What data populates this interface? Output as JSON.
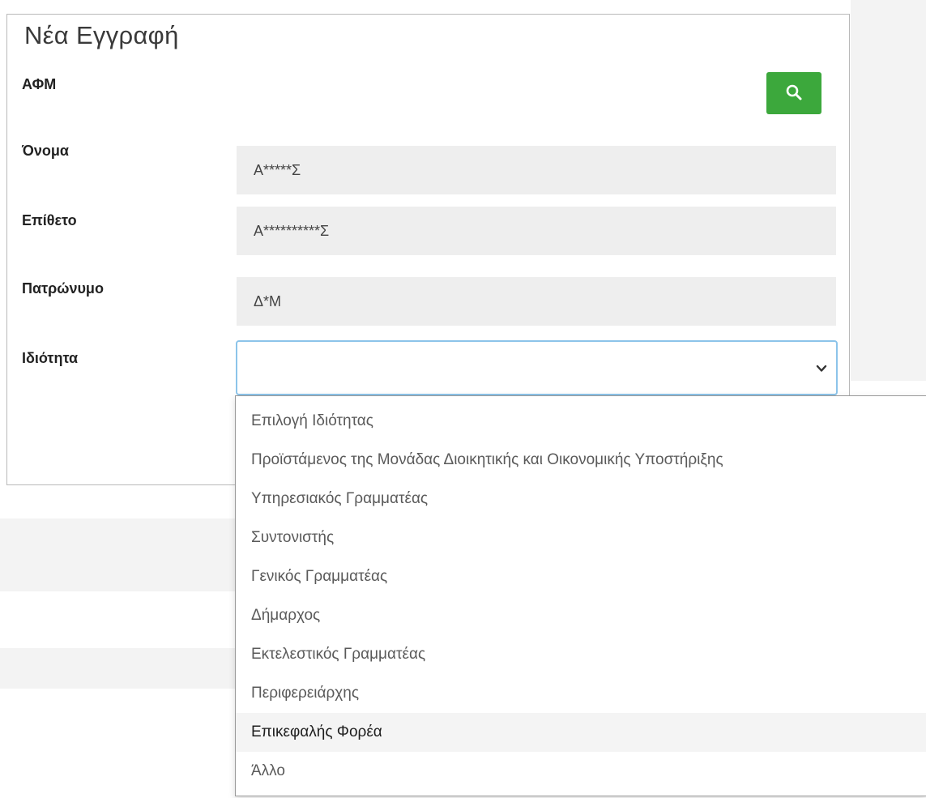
{
  "form": {
    "title": "Νέα Εγγραφή",
    "afm_label": "ΑΦΜ",
    "first_name_label": "Όνομα",
    "first_name_value": "Α*****Σ",
    "last_name_label": "Επίθετο",
    "last_name_value": "Α**********Σ",
    "father_name_label": "Πατρώνυμο",
    "father_name_value": "Δ*Μ",
    "capacity_label": "Ιδιότητα",
    "capacity_value": ""
  },
  "dropdown": {
    "options": [
      "Επιλογή Ιδιότητας",
      "Προϊστάμενος της Μονάδας Διοικητικής και Οικονομικής Υποστήριξης",
      "Υπηρεσιακός Γραμματέας",
      "Συντονιστής",
      "Γενικός Γραμματέας",
      "Δήμαρχος",
      "Εκτελεστικός Γραμματέας",
      "Περιφερειάρχης",
      "Επικεφαλής Φορέα",
      "Άλλο"
    ],
    "highlighted_option": "Επικεφαλής Φορέα"
  },
  "icons": {
    "search": "search-icon",
    "chevron": "chevron-down-icon"
  },
  "colors": {
    "search_button": "#3ca83c",
    "field_background": "#eeeeee",
    "select_focus_border": "#8cc4ea"
  }
}
